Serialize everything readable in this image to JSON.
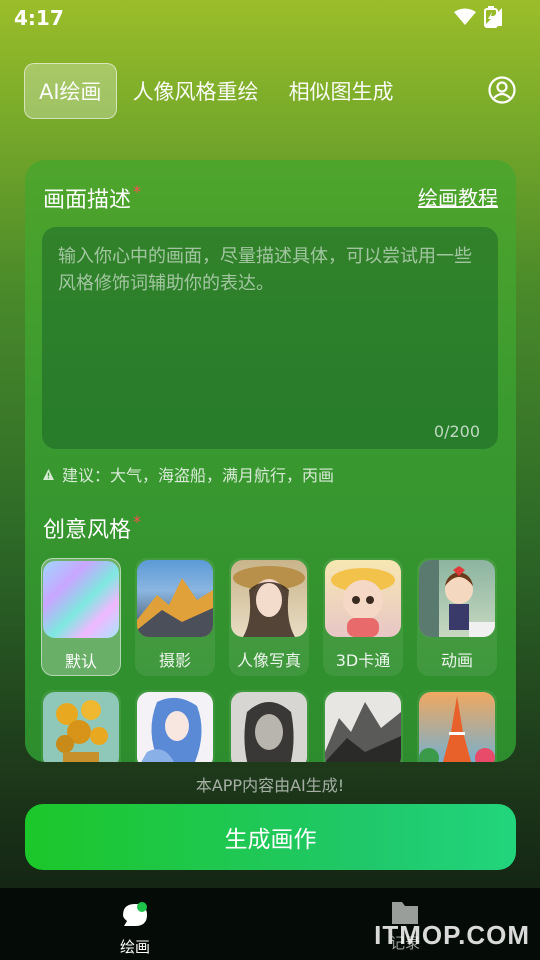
{
  "status": {
    "time": "4:17"
  },
  "tabs": [
    {
      "label": "AI绘画",
      "active": true
    },
    {
      "label": "人像风格重绘",
      "active": false
    },
    {
      "label": "相似图生成",
      "active": false
    }
  ],
  "icons": {
    "profile": "user-circle-icon",
    "wifi": "wifi-icon",
    "signal": "signal-icon",
    "battery": "battery-icon",
    "warning": "warning-icon",
    "draw": "chat-bubble-icon",
    "records": "folder-icon"
  },
  "description": {
    "title": "画面描述",
    "required_mark": "*",
    "tutorial_link": "绘画教程",
    "placeholder": "输入你心中的画面，尽量描述具体，可以尝试用一些风格修饰词辅助你的表达。",
    "counter": "0/200",
    "suggestion": "建议：大气，海盗船，满月航行，丙画"
  },
  "style": {
    "title": "创意风格",
    "required_mark": "*",
    "row1": [
      {
        "label": "默认",
        "active": true
      },
      {
        "label": "摄影",
        "active": false
      },
      {
        "label": "人像写真",
        "active": false
      },
      {
        "label": "3D卡通",
        "active": false
      },
      {
        "label": "动画",
        "active": false
      }
    ]
  },
  "disclaimer": "本APP内容由AI生成!",
  "generate_button": "生成画作",
  "bottom_nav": [
    {
      "label": "绘画",
      "active": true
    },
    {
      "label": "记录",
      "active": false
    }
  ],
  "watermark": "ITMOP.COM"
}
